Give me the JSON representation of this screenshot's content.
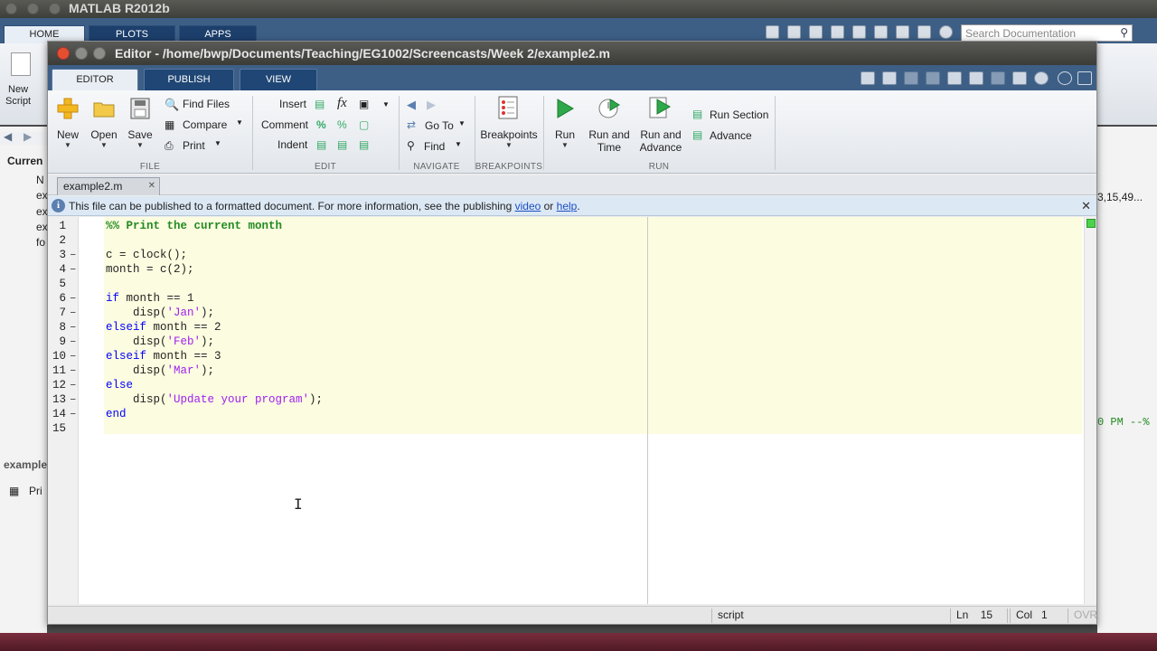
{
  "app": {
    "title": "MATLAB R2012b",
    "tabs": [
      "HOME",
      "PLOTS",
      "APPS"
    ],
    "search_placeholder": "Search Documentation",
    "new_script_label": "New\nScript"
  },
  "editor": {
    "title": "Editor - /home/bwp/Documents/Teaching/EG1002/Screencasts/Week 2/example2.m",
    "tabs": [
      "EDITOR",
      "PUBLISH",
      "VIEW"
    ],
    "ribbon": {
      "file": {
        "label": "FILE",
        "new": "New",
        "open": "Open",
        "save": "Save",
        "find_files": "Find Files",
        "compare": "Compare",
        "print": "Print"
      },
      "edit": {
        "label": "EDIT",
        "insert": "Insert",
        "comment": "Comment",
        "indent": "Indent"
      },
      "navigate": {
        "label": "NAVIGATE",
        "go_to": "Go To",
        "find": "Find"
      },
      "breakpoints": {
        "label": "BREAKPOINTS",
        "breakpoints": "Breakpoints"
      },
      "run": {
        "label": "RUN",
        "run": "Run",
        "run_and_time": "Run and\nTime",
        "run_and_advance": "Run and\nAdvance",
        "run_section": "Run Section",
        "advance": "Advance"
      }
    },
    "document_tab": "example2.m",
    "info_bar": {
      "prefix": "This file can be published to a formatted document. For more information, see the publishing ",
      "video_link": "video",
      "middle": " or ",
      "help_link": "help",
      "suffix": "."
    },
    "code_lines": [
      {
        "n": "1",
        "dash": false,
        "html": "<span class=\"cmt\">%% Print the current month</span>"
      },
      {
        "n": "2",
        "dash": false,
        "html": ""
      },
      {
        "n": "3",
        "dash": true,
        "html": "c = clock();"
      },
      {
        "n": "4",
        "dash": true,
        "html": "month = c(2);"
      },
      {
        "n": "5",
        "dash": false,
        "html": ""
      },
      {
        "n": "6",
        "dash": true,
        "html": "<span class=\"kw\">if</span> month == 1"
      },
      {
        "n": "7",
        "dash": true,
        "html": "    disp(<span class=\"str\">'Jan'</span>);"
      },
      {
        "n": "8",
        "dash": true,
        "html": "<span class=\"kw\">elseif</span> month == 2"
      },
      {
        "n": "9",
        "dash": true,
        "html": "    disp(<span class=\"str\">'Feb'</span>);"
      },
      {
        "n": "10",
        "dash": true,
        "html": "<span class=\"kw\">elseif</span> month == 3"
      },
      {
        "n": "11",
        "dash": true,
        "html": "    disp(<span class=\"str\">'Mar'</span>);"
      },
      {
        "n": "12",
        "dash": true,
        "html": "<span class=\"kw\">else</span>"
      },
      {
        "n": "13",
        "dash": true,
        "html": "    disp(<span class=\"str\">'Update your program'</span>);"
      },
      {
        "n": "14",
        "dash": true,
        "html": "<span class=\"kw\">end</span>"
      },
      {
        "n": "15",
        "dash": false,
        "html": ""
      }
    ],
    "status": {
      "mode": "script",
      "ln_label": "Ln",
      "ln_value": "15",
      "col_label": "Col",
      "col_value": "1",
      "ovr": "OVR"
    }
  },
  "background": {
    "current_folder": "Curren",
    "files": [
      "N",
      "ex",
      "ex",
      "ex",
      "fo"
    ],
    "details_file": "example",
    "print_label": "Pri",
    "workspace_value": "3,15,49...",
    "history_text": "0 PM --%"
  },
  "colors": {
    "tabstrip": "#3d5f86",
    "cell_highlight": "#fcfce0",
    "keyword": "#0000ff",
    "string": "#a020f0",
    "comment": "#228b22"
  }
}
